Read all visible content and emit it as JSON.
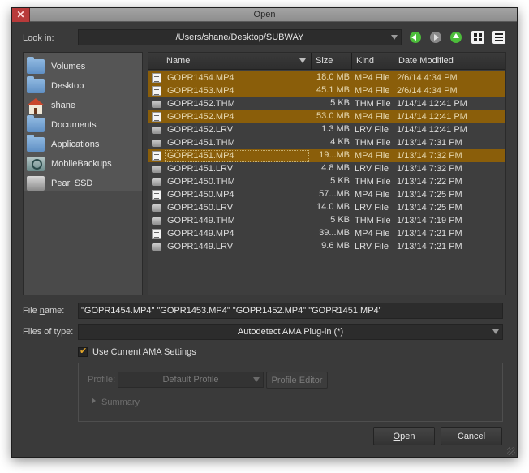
{
  "window": {
    "title": "Open"
  },
  "look_in": {
    "label": "Look in:",
    "path": "/Users/shane/Desktop/SUBWAY"
  },
  "sidebar": {
    "items": [
      {
        "label": "Volumes",
        "icon": "folder-icon"
      },
      {
        "label": "Desktop",
        "icon": "folder-icon"
      },
      {
        "label": "shane",
        "icon": "home-icon"
      },
      {
        "label": "Documents",
        "icon": "folder-icon"
      },
      {
        "label": "Applications",
        "icon": "applications-folder-icon"
      },
      {
        "label": "MobileBackups",
        "icon": "time-machine-drive-icon"
      },
      {
        "label": "Pearl SSD",
        "icon": "drive-icon"
      }
    ]
  },
  "file_list": {
    "columns": {
      "name": "Name",
      "size": "Size",
      "kind": "Kind",
      "date": "Date Modified"
    },
    "rows": [
      {
        "name": "GOPR1454.MP4",
        "size": "18.0 MB",
        "kind": "MP4 File",
        "date": "2/6/14 4:34 PM",
        "selected": true,
        "icon": "doc"
      },
      {
        "name": "GOPR1453.MP4",
        "size": "45.1 MB",
        "kind": "MP4 File",
        "date": "2/6/14 4:34 PM",
        "selected": true,
        "icon": "doc"
      },
      {
        "name": "GOPR1452.THM",
        "size": "5 KB",
        "kind": "THM File",
        "date": "1/14/14 12:41 PM",
        "selected": false,
        "icon": "gen"
      },
      {
        "name": "GOPR1452.MP4",
        "size": "53.0 MB",
        "kind": "MP4 File",
        "date": "1/14/14 12:41 PM",
        "selected": true,
        "icon": "doc"
      },
      {
        "name": "GOPR1452.LRV",
        "size": "1.3 MB",
        "kind": "LRV File",
        "date": "1/14/14 12:41 PM",
        "selected": false,
        "icon": "gen"
      },
      {
        "name": "GOPR1451.THM",
        "size": "4 KB",
        "kind": "THM File",
        "date": "1/13/14 7:31 PM",
        "selected": false,
        "icon": "gen"
      },
      {
        "name": "GOPR1451.MP4",
        "size": "19...MB",
        "kind": "MP4 File",
        "date": "1/13/14 7:32 PM",
        "selected": true,
        "focus": true,
        "icon": "doc"
      },
      {
        "name": "GOPR1451.LRV",
        "size": "4.8 MB",
        "kind": "LRV File",
        "date": "1/13/14 7:32 PM",
        "selected": false,
        "icon": "gen"
      },
      {
        "name": "GOPR1450.THM",
        "size": "5 KB",
        "kind": "THM File",
        "date": "1/13/14 7:22 PM",
        "selected": false,
        "icon": "gen"
      },
      {
        "name": "GOPR1450.MP4",
        "size": "57...MB",
        "kind": "MP4 File",
        "date": "1/13/14 7:25 PM",
        "selected": false,
        "icon": "doc"
      },
      {
        "name": "GOPR1450.LRV",
        "size": "14.0 MB",
        "kind": "LRV File",
        "date": "1/13/14 7:25 PM",
        "selected": false,
        "icon": "gen"
      },
      {
        "name": "GOPR1449.THM",
        "size": "5 KB",
        "kind": "THM File",
        "date": "1/13/14 7:19 PM",
        "selected": false,
        "icon": "gen"
      },
      {
        "name": "GOPR1449.MP4",
        "size": "39...MB",
        "kind": "MP4 File",
        "date": "1/13/14 7:21 PM",
        "selected": false,
        "icon": "doc"
      },
      {
        "name": "GOPR1449.LRV",
        "size": "9.6 MB",
        "kind": "LRV File",
        "date": "1/13/14 7:21 PM",
        "selected": false,
        "icon": "gen"
      }
    ]
  },
  "file_name": {
    "label_prefix": "File ",
    "label_mnemonic": "n",
    "label_suffix": "ame:",
    "value": "\"GOPR1454.MP4\" \"GOPR1453.MP4\" \"GOPR1452.MP4\" \"GOPR1451.MP4\""
  },
  "file_type": {
    "label": "Files of type:",
    "value": "Autodetect AMA Plug-in (*)"
  },
  "ama_settings": {
    "label": "Use Current AMA Settings",
    "checked": true
  },
  "profile": {
    "label": "Profile:",
    "value": "Default Profile",
    "editor_label": "Profile Editor",
    "summary_label": "Summary"
  },
  "actions": {
    "open_mnemonic": "O",
    "open_rest": "pen",
    "cancel": "Cancel"
  },
  "colors": {
    "selection": "#8a5e0a",
    "window_bg": "#3a3a3a",
    "nav_green": "#4cbd3a",
    "checkmark": "#e6a82a"
  }
}
